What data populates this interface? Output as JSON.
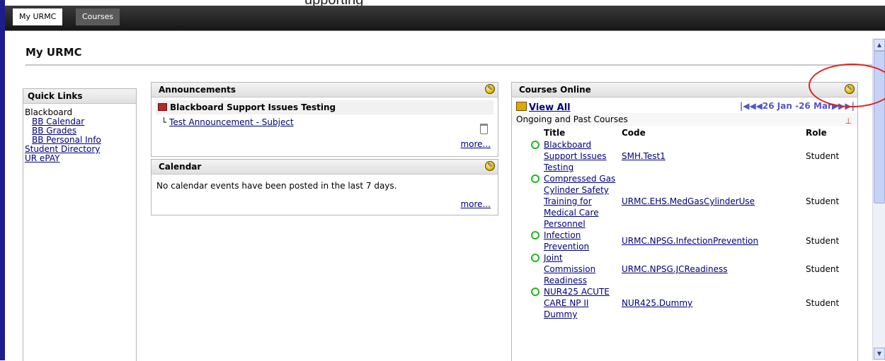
{
  "header_fragment": "upporting",
  "tabs": [
    {
      "label": "My URMC"
    },
    {
      "label": "Courses"
    }
  ],
  "page_title": "My URMC",
  "quick_links": {
    "title": "Quick Links",
    "items": [
      "Blackboard",
      "BB Calendar",
      "BB Grades",
      "BB Personal Info",
      "Student Directory",
      "UR ePAY"
    ]
  },
  "announcements": {
    "title": "Announcements",
    "item_title": "Blackboard Support Issues Testing",
    "item_subject": "Test Announcement - Subject",
    "more": "more..."
  },
  "calendar": {
    "title": "Calendar",
    "message": "No calendar events have been posted in the last 7 days.",
    "more": "more..."
  },
  "courses_online": {
    "title": "Courses Online",
    "view_all": "View All",
    "date_range": "26 Jan -26 Mar",
    "ongoing_label": "Ongoing and Past Courses",
    "columns": {
      "title": "Title",
      "code": "Code",
      "role": "Role"
    },
    "courses": [
      {
        "title_lines": [
          "Blackboard",
          "Support Issues",
          "Testing"
        ],
        "code": "SMH.Test1",
        "role": "Student"
      },
      {
        "title_lines": [
          "Compressed Gas",
          "Cylinder Safety",
          "Training for",
          "Medical Care",
          "Personnel"
        ],
        "code": "URMC.EHS.MedGasCylinderUse",
        "role": "Student"
      },
      {
        "title_lines": [
          "Infection",
          "Prevention"
        ],
        "code": "URMC.NPSG.InfectionPrevention",
        "role": "Student"
      },
      {
        "title_lines": [
          "Joint",
          "Commission",
          "Readiness"
        ],
        "code": "URMC.NPSG.JCReadiness",
        "role": "Student"
      },
      {
        "title_lines": [
          "NUR425 ACUTE",
          "CARE NP II",
          "Dummy"
        ],
        "code": "NUR425.Dummy",
        "role": "Student"
      }
    ]
  },
  "colors": {
    "accent": "#1c1c8c",
    "link": "#00007a",
    "annotation": "#e02020",
    "status_green": "#1fb81f"
  }
}
